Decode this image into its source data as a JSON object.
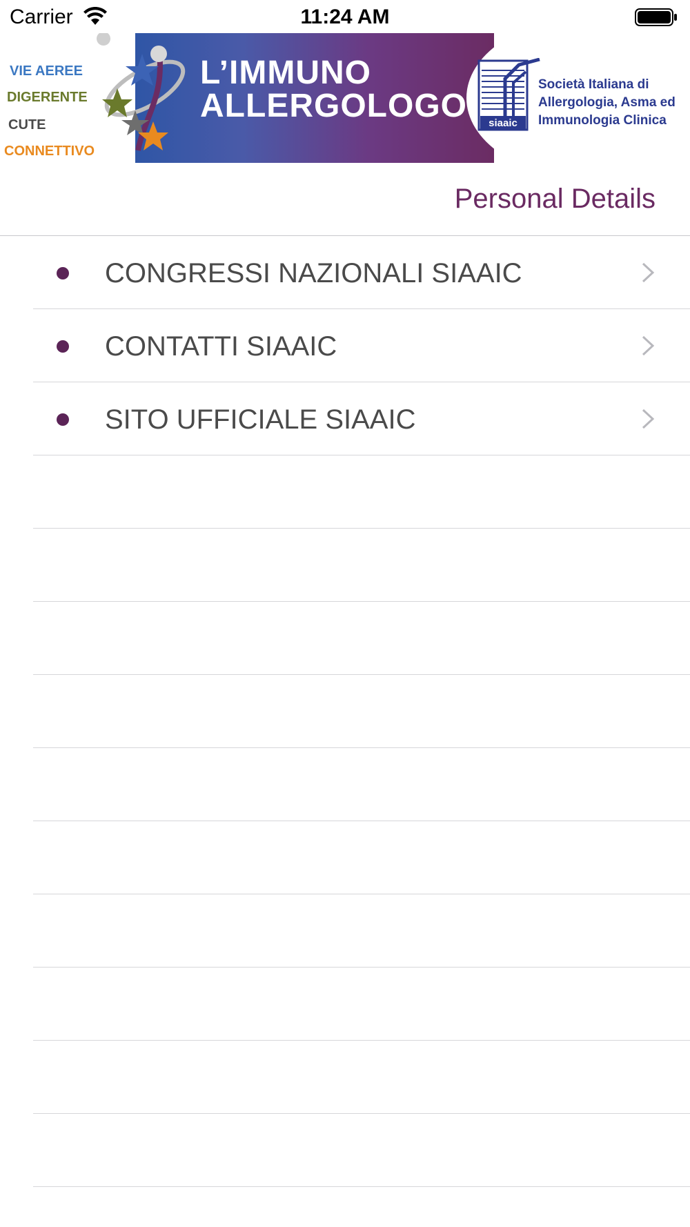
{
  "status_bar": {
    "carrier": "Carrier",
    "time": "11:24 AM"
  },
  "banner": {
    "title_line1": "L’IMMUNO",
    "title_line2": "ALLERGOLOGO",
    "categories": [
      "VIE AEREE",
      "DIGERENTE",
      "CUTE",
      "CONNETTIVO"
    ],
    "society_logo_text": "siaaic",
    "society_name": [
      "Società Italiana di",
      "Allergologia, Asma ed",
      "Immunologia Clinica"
    ]
  },
  "header": {
    "title": "Personal Details"
  },
  "menu": {
    "items": [
      {
        "label": "CONGRESSI NAZIONALI SIAAIC"
      },
      {
        "label": "CONTATTI SIAAIC"
      },
      {
        "label": "SITO UFFICIALE SIAAIC"
      }
    ],
    "empty_rows": 10
  },
  "colors": {
    "accent": "#6a2a62",
    "bullet": "#5b2457",
    "separator": "#d6d6d9",
    "text": "#4a4a4a"
  }
}
